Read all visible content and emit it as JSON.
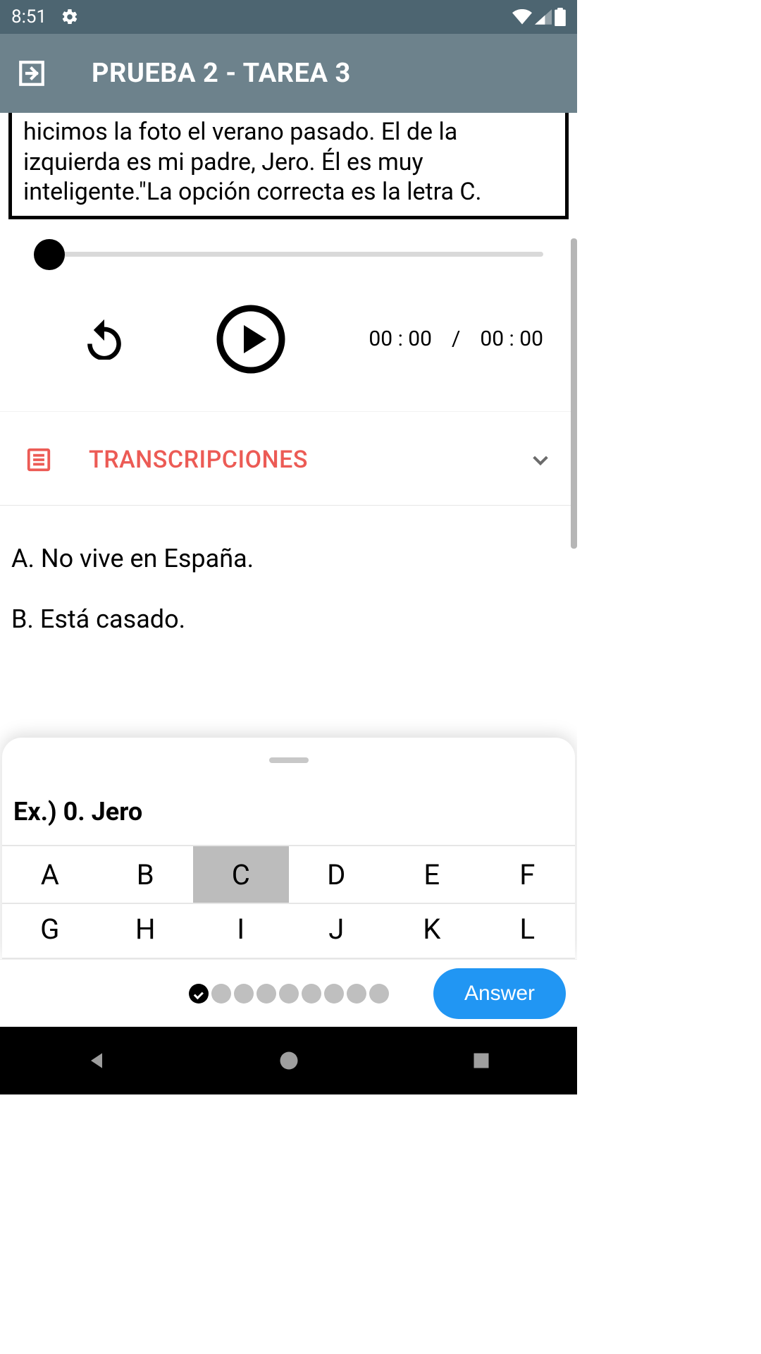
{
  "status": {
    "time": "8:51"
  },
  "header": {
    "title": "PRUEBA 2 - TAREA 3"
  },
  "passage": {
    "text": "hicimos la foto el verano pasado. El de la izquierda es mi padre, Jero. Él es muy inteligente.\"La opción correcta es la letra C."
  },
  "audio": {
    "current": "00 : 00",
    "separator": "/",
    "total": "00 : 00"
  },
  "transcripts": {
    "label": "TRANSCRIPCIONES"
  },
  "options": {
    "a": "A. No vive en España.",
    "b": "B. Está casado."
  },
  "sheet": {
    "title": "Ex.) 0. Jero",
    "row1": [
      "A",
      "B",
      "C",
      "D",
      "E",
      "F"
    ],
    "row2": [
      "G",
      "H",
      "I",
      "J",
      "K",
      "L"
    ],
    "selected": "C"
  },
  "bottom": {
    "answer": "Answer"
  }
}
